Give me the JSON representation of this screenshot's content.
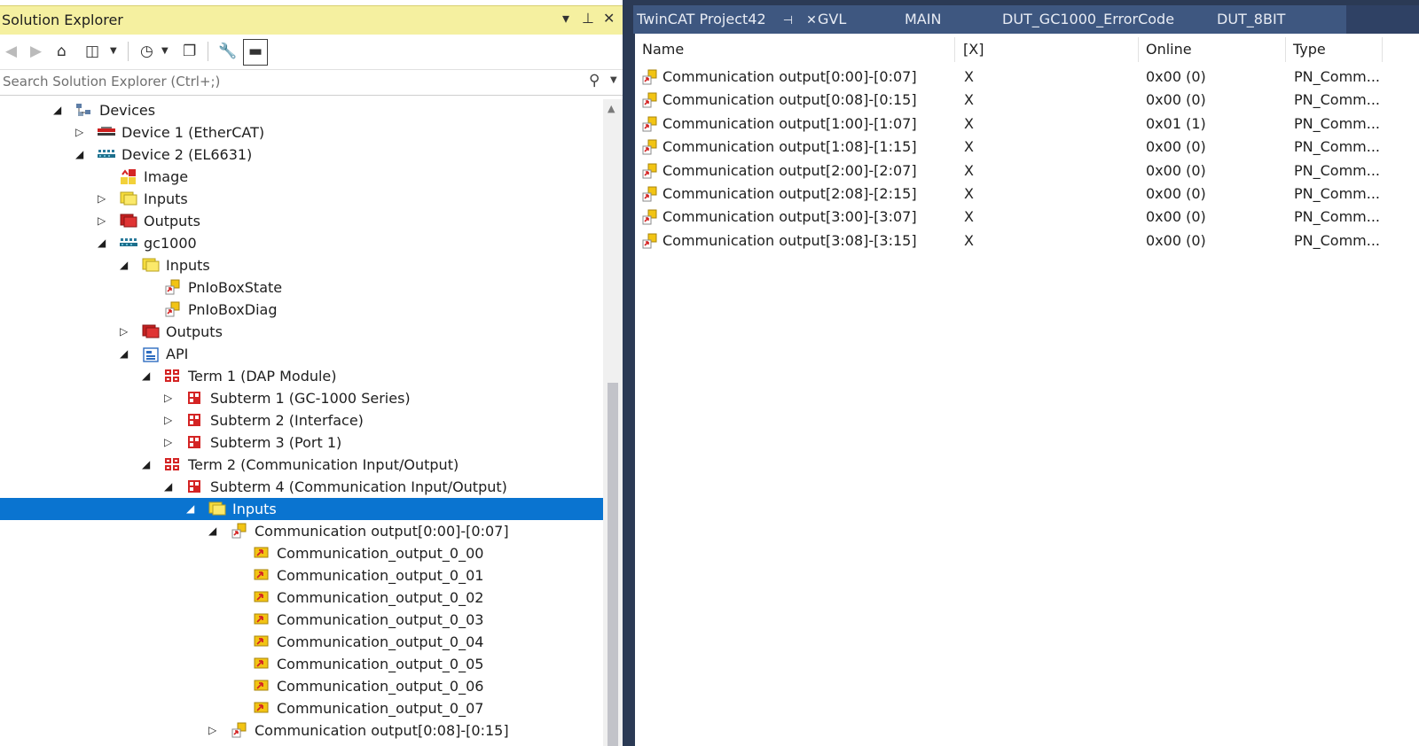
{
  "solution_explorer": {
    "title": "Solution Explorer",
    "controls": [
      "▾",
      "⊥",
      "✕"
    ],
    "search_placeholder": "Search Solution Explorer (Ctrl+;)"
  },
  "tree": [
    {
      "label": "Devices",
      "depth": 0,
      "expander": "open",
      "icon": "devices-icon"
    },
    {
      "label": "Device 1 (EtherCAT)",
      "depth": 1,
      "expander": "closed",
      "icon": "ethercat-device-icon"
    },
    {
      "label": "Device 2 (EL6631)",
      "depth": 1,
      "expander": "open",
      "icon": "profinet-device-icon"
    },
    {
      "label": "Image",
      "depth": 2,
      "expander": "none",
      "icon": "image-icon"
    },
    {
      "label": "Inputs",
      "depth": 2,
      "expander": "closed",
      "icon": "inputs-folder-icon"
    },
    {
      "label": "Outputs",
      "depth": 2,
      "expander": "closed",
      "icon": "outputs-folder-icon"
    },
    {
      "label": "gc1000",
      "depth": 2,
      "expander": "open",
      "icon": "box-icon"
    },
    {
      "label": "Inputs",
      "depth": 3,
      "expander": "open",
      "icon": "inputs-folder-icon"
    },
    {
      "label": "PnIoBoxState",
      "depth": 4,
      "expander": "none",
      "icon": "variable-icon"
    },
    {
      "label": "PnIoBoxDiag",
      "depth": 4,
      "expander": "none",
      "icon": "variable-icon"
    },
    {
      "label": "Outputs",
      "depth": 3,
      "expander": "closed",
      "icon": "outputs-folder-icon"
    },
    {
      "label": "API",
      "depth": 3,
      "expander": "open",
      "icon": "api-icon"
    },
    {
      "label": "Term 1 (DAP Module)",
      "depth": 4,
      "expander": "open",
      "icon": "term-icon"
    },
    {
      "label": "Subterm 1 (GC-1000 Series)",
      "depth": 5,
      "expander": "closed",
      "icon": "subterm-icon"
    },
    {
      "label": "Subterm 2 (Interface)",
      "depth": 5,
      "expander": "closed",
      "icon": "subterm-icon"
    },
    {
      "label": "Subterm 3 (Port 1)",
      "depth": 5,
      "expander": "closed",
      "icon": "subterm-icon"
    },
    {
      "label": "Term 2 (Communication Input/Output)",
      "depth": 4,
      "expander": "open",
      "icon": "term-icon"
    },
    {
      "label": "Subterm 4 (Communication Input/Output)",
      "depth": 5,
      "expander": "open",
      "icon": "subterm-icon"
    },
    {
      "label": "Inputs",
      "depth": 6,
      "expander": "open",
      "icon": "inputs-folder-icon",
      "selected": true
    },
    {
      "label": "Communication output[0:00]-[0:07]",
      "depth": 7,
      "expander": "open",
      "icon": "variable-icon"
    },
    {
      "label": "Communication_output_0_00",
      "depth": 8,
      "expander": "none",
      "icon": "bit-variable-icon"
    },
    {
      "label": "Communication_output_0_01",
      "depth": 8,
      "expander": "none",
      "icon": "bit-variable-icon"
    },
    {
      "label": "Communication_output_0_02",
      "depth": 8,
      "expander": "none",
      "icon": "bit-variable-icon"
    },
    {
      "label": "Communication_output_0_03",
      "depth": 8,
      "expander": "none",
      "icon": "bit-variable-icon"
    },
    {
      "label": "Communication_output_0_04",
      "depth": 8,
      "expander": "none",
      "icon": "bit-variable-icon"
    },
    {
      "label": "Communication_output_0_05",
      "depth": 8,
      "expander": "none",
      "icon": "bit-variable-icon"
    },
    {
      "label": "Communication_output_0_06",
      "depth": 8,
      "expander": "none",
      "icon": "bit-variable-icon"
    },
    {
      "label": "Communication_output_0_07",
      "depth": 8,
      "expander": "none",
      "icon": "bit-variable-icon"
    },
    {
      "label": "Communication output[0:08]-[0:15]",
      "depth": 7,
      "expander": "closed",
      "icon": "variable-icon"
    }
  ],
  "tabs": [
    "TwinCAT Project42",
    "GVL",
    "MAIN",
    "DUT_GC1000_ErrorCode",
    "DUT_8BIT"
  ],
  "tab_pin": "⊣",
  "tab_close": "✕",
  "grid": {
    "columns": [
      "Name",
      "[X]",
      "Online",
      "Type"
    ],
    "rows": [
      {
        "name": "Communication output[0:00]-[0:07]",
        "x": "X",
        "online": "0x00 (0)",
        "type": "PN_Comm..."
      },
      {
        "name": "Communication output[0:08]-[0:15]",
        "x": "X",
        "online": "0x00 (0)",
        "type": "PN_Comm..."
      },
      {
        "name": "Communication output[1:00]-[1:07]",
        "x": "X",
        "online": "0x01 (1)",
        "type": "PN_Comm..."
      },
      {
        "name": "Communication output[1:08]-[1:15]",
        "x": "X",
        "online": "0x00 (0)",
        "type": "PN_Comm..."
      },
      {
        "name": "Communication output[2:00]-[2:07]",
        "x": "X",
        "online": "0x00 (0)",
        "type": "PN_Comm..."
      },
      {
        "name": "Communication output[2:08]-[2:15]",
        "x": "X",
        "online": "0x00 (0)",
        "type": "PN_Comm..."
      },
      {
        "name": "Communication output[3:00]-[3:07]",
        "x": "X",
        "online": "0x00 (0)",
        "type": "PN_Comm..."
      },
      {
        "name": "Communication output[3:08]-[3:15]",
        "x": "X",
        "online": "0x00 (0)",
        "type": "PN_Comm..."
      }
    ]
  },
  "colors": {
    "title_bar": "#f5f0a0",
    "selection": "#0a74d0",
    "tab_strip": "#2f4164",
    "tab_active": "#3e5780"
  }
}
